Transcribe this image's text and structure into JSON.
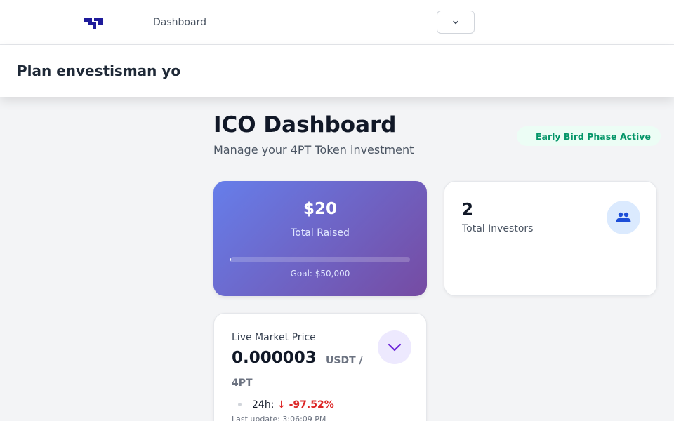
{
  "nav": {
    "logo_icon": "4pt-logo-icon",
    "links": [
      "Dashboard"
    ],
    "dropdown_icon": "chevron-down-icon"
  },
  "header": {
    "title": "Plan envestisman yo"
  },
  "main": {
    "title": "ICO Dashboard",
    "subtitle": "Manage your 4PT Token investment",
    "badge": "Early Bird Phase Active"
  },
  "raised_card": {
    "amount": "$20",
    "label": "Total Raised",
    "progress_fraction": 0.0004,
    "goal": "Goal: $50,000"
  },
  "investors_card": {
    "count": "2",
    "label": "Total Investors",
    "icon": "users-icon"
  },
  "market_card": {
    "label": "Live Market Price",
    "price": "0.000003",
    "unit_a": "USDT /",
    "unit_b": "4PT",
    "change_label": "24h:",
    "change_value": "↓ -97.52%",
    "last_update": "Last update: 3:06:09 PM",
    "icon": "chevron-down-icon"
  },
  "colors": {
    "gradient_start": "#667eea",
    "gradient_end": "#764ba2",
    "badge_green": "#059669",
    "negative_red": "#dc2626",
    "logo_blue": "#1e1b9b"
  }
}
